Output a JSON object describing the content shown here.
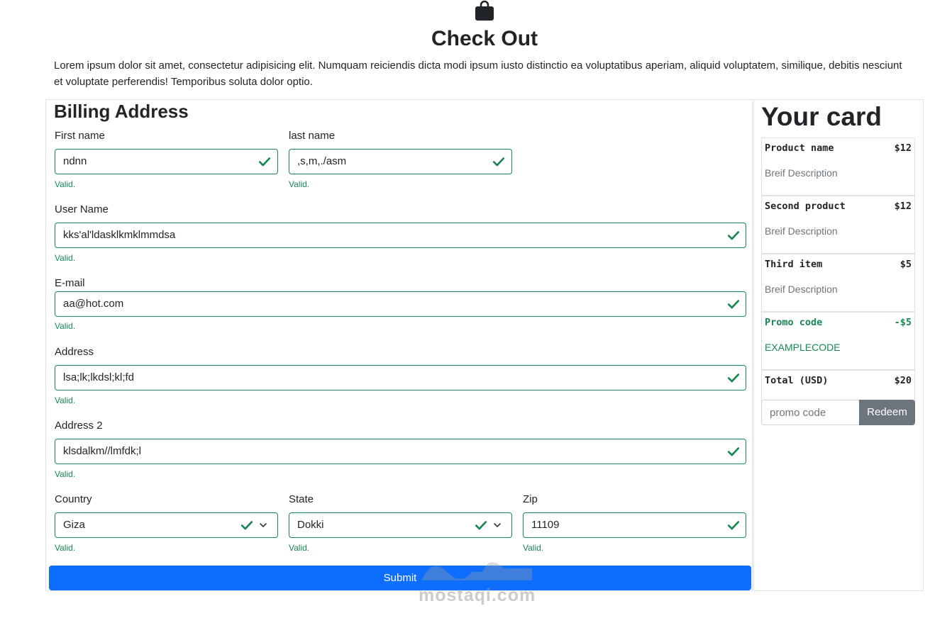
{
  "header": {
    "title": "Check Out",
    "intro": "Lorem ipsum dolor sit amet, consectetur adipisicing elit. Numquam reiciendis dicta modi ipsum iusto distinctio ea voluptatibus aperiam, aliquid voluptatem, similique, debitis nesciunt et voluptate perferendis! Temporibus soluta dolor optio."
  },
  "billing": {
    "title": "Billing Address",
    "first_name": {
      "label": "First name",
      "value": "ndnn",
      "feedback": "Valid."
    },
    "last_name": {
      "label": "last name",
      "value": ",s,m,./asm",
      "feedback": "Valid."
    },
    "username": {
      "label": "User Name",
      "value": "kks'al'ldasklkmklmmdsa",
      "feedback": "Valid."
    },
    "email": {
      "label": "E-mail",
      "value": "aa@hot.com",
      "feedback": "Valid."
    },
    "address": {
      "label": "Address",
      "value": "lsa;lk;lkdsl;kl;fd",
      "feedback": "Valid."
    },
    "address2": {
      "label": "Address 2",
      "value": "klsdalkm//lmfdk;l",
      "feedback": "Valid."
    },
    "country": {
      "label": "Country",
      "value": "Giza",
      "feedback": "Valid."
    },
    "state": {
      "label": "State",
      "value": "Dokki",
      "feedback": "Valid."
    },
    "zip": {
      "label": "Zip",
      "value": "11109",
      "feedback": "Valid."
    },
    "submit_label": "Submit"
  },
  "cart": {
    "title": "Your card",
    "items": [
      {
        "name": "Product name",
        "price": "$12",
        "desc": "Breif Description"
      },
      {
        "name": "Second product",
        "price": "$12",
        "desc": "Breif Description"
      },
      {
        "name": "Third item",
        "price": "$5",
        "desc": "Breif Description"
      }
    ],
    "promo": {
      "name": "Promo code",
      "price": "-$5",
      "desc": "EXAMPLECODE"
    },
    "total": {
      "name": "Total (USD)",
      "price": "$20"
    },
    "promo_placeholder": "promo code",
    "redeem_label": "Redeem"
  },
  "watermark": {
    "text": "mostaqi.com"
  },
  "colors": {
    "valid": "#198754",
    "primary": "#0d6efd",
    "secondary": "#6c757d"
  },
  "icons": {
    "bag": "shopping-bag-icon",
    "check": "check-icon",
    "chevron": "chevron-down-icon"
  }
}
